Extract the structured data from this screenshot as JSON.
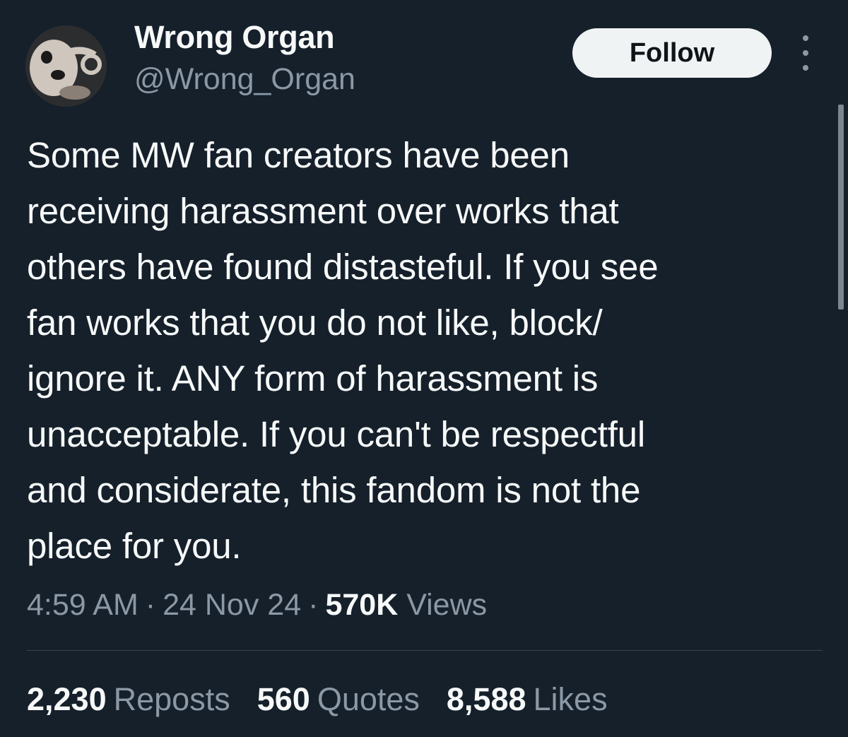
{
  "author": {
    "display_name": "Wrong Organ",
    "handle": "@Wrong_Organ"
  },
  "actions": {
    "follow_label": "Follow",
    "more_icon": "more-vertical-icon"
  },
  "tweet": {
    "text": "Some MW fan creators have been\nreceiving harassment over works that\nothers have found distasteful. If you see\nfan works that you do not like, block/\nignore it. ANY form of harassment is\nunacceptable. If you can't be respectful\nand considerate, this fandom is not the\nplace for you.",
    "time": "4:59 AM",
    "separator": "·",
    "date": "24 Nov 24",
    "views_count": "570K",
    "views_label": "Views"
  },
  "stats": {
    "reposts_count": "2,230",
    "reposts_label": "Reposts",
    "quotes_count": "560",
    "quotes_label": "Quotes",
    "likes_count": "8,588",
    "likes_label": "Likes"
  },
  "colors": {
    "background": "#15202b",
    "text_primary": "#f7f9f9",
    "text_secondary": "#8b98a5",
    "button_bg": "#eff3f4",
    "divider": "#38444d"
  }
}
